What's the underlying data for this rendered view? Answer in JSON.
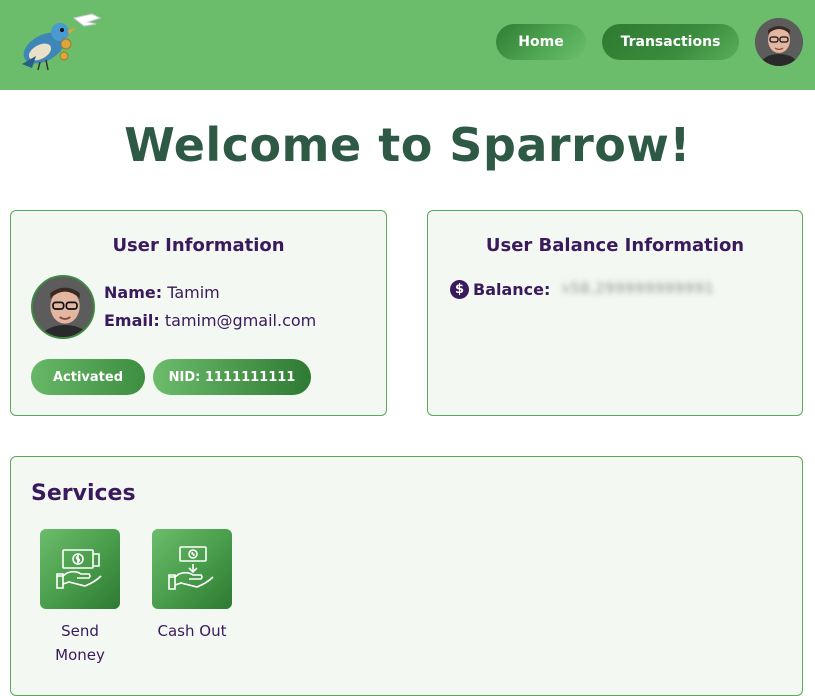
{
  "header": {
    "nav": {
      "home_label": "Home",
      "transactions_label": "Transactions"
    }
  },
  "welcome": {
    "title": "Welcome to Sparrow!"
  },
  "user_card": {
    "title": "User Information",
    "name_key": "Name:",
    "name_value": "Tamim",
    "email_key": "Email:",
    "email_value": "tamim@gmail.com",
    "status_badge": "Activated",
    "nid_badge": "NID: 1111111111"
  },
  "balance_card": {
    "title": "User Balance Information",
    "balance_key": "Balance:",
    "balance_value": "৳58,299999999991"
  },
  "services": {
    "title": "Services",
    "items": [
      {
        "label": "Send Money",
        "icon": "send-money-icon"
      },
      {
        "label": "Cash Out",
        "icon": "cash-out-icon"
      }
    ]
  },
  "colors": {
    "header_bg": "#6bbd6b",
    "accent_dark": "#2f7a33",
    "text_purple": "#3a1a5c",
    "card_bg": "#f3f8f2"
  }
}
